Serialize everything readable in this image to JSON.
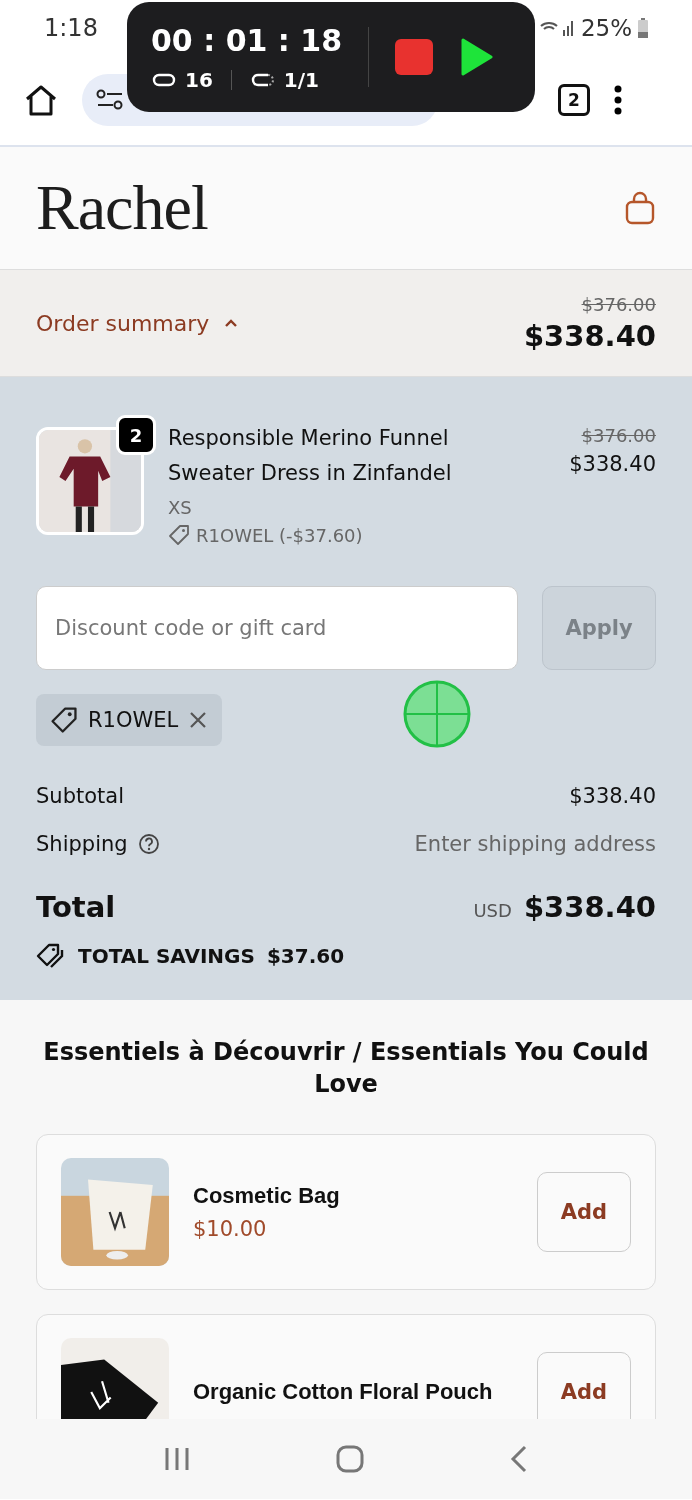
{
  "status_bar": {
    "time": "1:18",
    "battery": "25%"
  },
  "recorder": {
    "elapsed": "00 : 01 : 18",
    "loops": "16",
    "repeat": "1/1"
  },
  "browser": {
    "tab_count": "2"
  },
  "store": {
    "logo": "Rachel"
  },
  "order_summary": {
    "label": "Order summary",
    "expanded": true,
    "original_total": "$376.00",
    "total": "$338.40"
  },
  "line_items": [
    {
      "title": "Responsible Merino Funnel Sweater Dress in Zinfandel",
      "quantity": "2",
      "variant": "XS",
      "discount": "R1OWEL (-$37.60)",
      "original_price": "$376.00",
      "price": "$338.40"
    }
  ],
  "discount": {
    "placeholder": "Discount code or gift card",
    "button": "Apply",
    "applied_code": "R1OWEL"
  },
  "totals": {
    "subtotal_label": "Subtotal",
    "subtotal": "$338.40",
    "shipping_label": "Shipping",
    "shipping": "Enter shipping address",
    "total_label": "Total",
    "currency": "USD",
    "total": "$338.40",
    "savings_label": "TOTAL SAVINGS",
    "savings": "$37.60"
  },
  "recommendations": {
    "title": "Essentiels à Découvrir / Essentials You Could Love",
    "items": [
      {
        "name": "Cosmetic Bag",
        "price": "$10.00",
        "button": "Add",
        "kind": "light"
      },
      {
        "name": "Organic Cotton Floral Pouch",
        "button": "Add",
        "kind": "dark"
      }
    ]
  }
}
